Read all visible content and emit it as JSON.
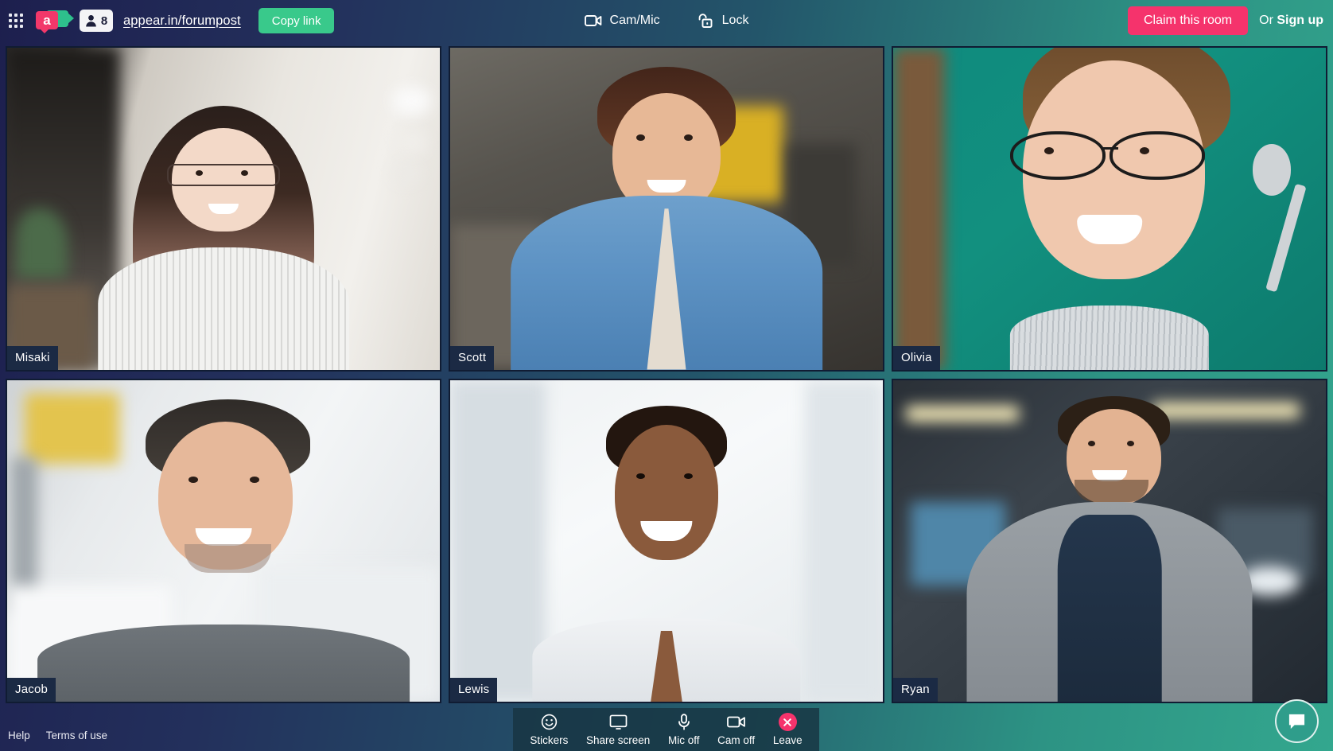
{
  "header": {
    "apps_icon": "grid-apps-icon",
    "logo_letter": "a",
    "logo_icon": "appear-in-logo",
    "participant_icon": "person-icon",
    "participant_count": "8",
    "room_url": "appear.in/forumpost",
    "copy_link_label": "Copy link",
    "cam_mic_label": "Cam/Mic",
    "cam_mic_icon": "video-camera-icon",
    "lock_label": "Lock",
    "lock_icon": "unlocked-padlock-icon",
    "claim_label": "Claim this room",
    "or_label": "Or ",
    "signup_label": "Sign up"
  },
  "colors": {
    "brand_pink": "#f5336c",
    "brand_green": "#39c98b",
    "teal": "#2f9d8b",
    "navy": "#1d1f4e",
    "name_tag_bg": "#1b2a44"
  },
  "grid": {
    "tiles": [
      {
        "name": "Misaki"
      },
      {
        "name": "Scott"
      },
      {
        "name": "Olivia"
      },
      {
        "name": "Jacob"
      },
      {
        "name": "Lewis"
      },
      {
        "name": "Ryan"
      }
    ]
  },
  "footer": {
    "help_label": "Help",
    "terms_label": "Terms of use",
    "tools": [
      {
        "label": "Stickers",
        "icon": "smiley-face-icon"
      },
      {
        "label": "Share screen",
        "icon": "monitor-icon"
      },
      {
        "label": "Mic off",
        "icon": "microphone-icon"
      },
      {
        "label": "Cam off",
        "icon": "video-camera-icon"
      },
      {
        "label": "Leave",
        "icon": "close-x-circle-icon"
      }
    ],
    "chat_icon": "chat-bubble-icon"
  }
}
